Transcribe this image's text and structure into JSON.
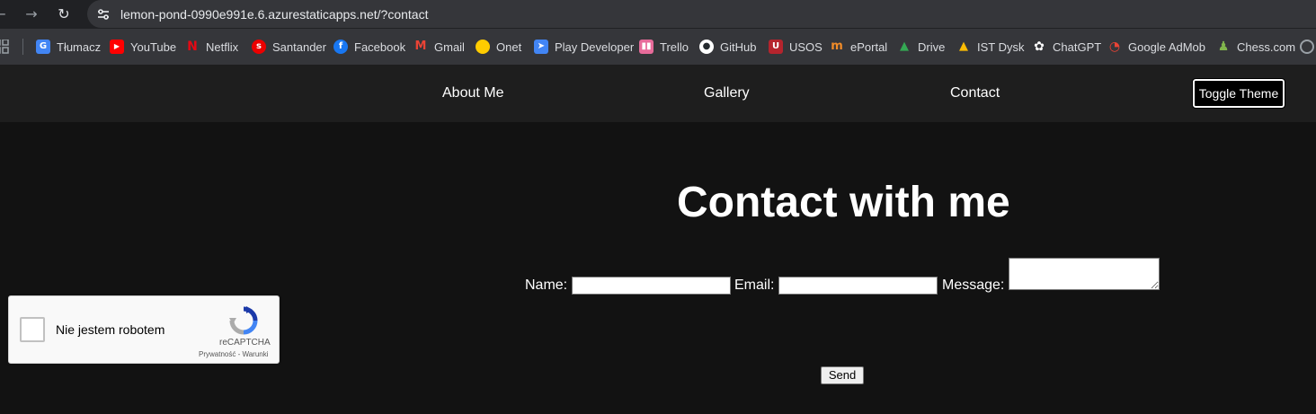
{
  "browser": {
    "url": "lemon-pond-0990e991e.6.azurestaticapps.net/?contact",
    "bookmarks": [
      {
        "label": "Tłumacz",
        "icon": "google-translate-icon",
        "color": "#4285f4"
      },
      {
        "label": "YouTube",
        "icon": "youtube-icon",
        "color": "#ff0000"
      },
      {
        "label": "Netflix",
        "icon": "netflix-icon",
        "color": "#e50914"
      },
      {
        "label": "Santander",
        "icon": "santander-icon",
        "color": "#ec0000"
      },
      {
        "label": "Facebook",
        "icon": "facebook-icon",
        "color": "#1877f2"
      },
      {
        "label": "Gmail",
        "icon": "gmail-icon",
        "color": "#ea4335"
      },
      {
        "label": "Onet",
        "icon": "onet-icon",
        "color": "#ffcc00"
      },
      {
        "label": "Play Developer",
        "icon": "play-developer-icon",
        "color": "#4285f4"
      },
      {
        "label": "Trello",
        "icon": "trello-icon",
        "color": "#e76b9a"
      },
      {
        "label": "GitHub",
        "icon": "github-icon",
        "color": "#ffffff"
      },
      {
        "label": "USOS",
        "icon": "usos-icon",
        "color": "#b5242d"
      },
      {
        "label": "ePortal",
        "icon": "eportal-icon",
        "color": "#f28c28"
      },
      {
        "label": "Drive",
        "icon": "google-drive-icon",
        "color": "#34a853"
      },
      {
        "label": "IST Dysk",
        "icon": "google-drive-icon",
        "color": "#fbbc04"
      },
      {
        "label": "ChatGPT",
        "icon": "chatgpt-icon",
        "color": "#ffffff"
      },
      {
        "label": "Google AdMob",
        "icon": "admob-icon",
        "color": "#ea4335"
      },
      {
        "label": "Chess.com",
        "icon": "chess-icon",
        "color": "#81b64c"
      }
    ]
  },
  "nav": {
    "about": "About Me",
    "gallery": "Gallery",
    "contact": "Contact",
    "toggle": "Toggle Theme"
  },
  "content": {
    "title": "Contact with me",
    "name_label": "Name:",
    "email_label": "Email:",
    "message_label": "Message:",
    "send": "Send"
  },
  "captcha": {
    "label": "Nie jestem robotem",
    "brand": "reCAPTCHA",
    "links": "Prywatność - Warunki"
  },
  "colors": {
    "page_bg": "#121212",
    "nav_bg": "#1e1e1e",
    "text": "#ffffff"
  }
}
